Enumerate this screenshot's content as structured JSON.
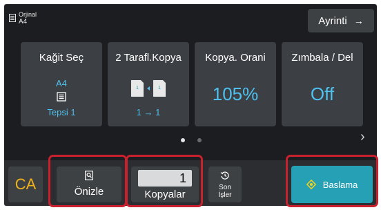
{
  "header": {
    "original_label": "Orjinal",
    "original_size": "A4",
    "detail_label": "Ayrinti",
    "detail_arrow": "→"
  },
  "functions": {
    "paper": {
      "title": "Kağit Seç",
      "size": "A4",
      "tray": "Tepsi 1"
    },
    "duplex": {
      "title": "2 Tarafl.Kopya",
      "mode": "1 → 1"
    },
    "ratio": {
      "title": "Kopya. Orani",
      "value": "105%"
    },
    "staple": {
      "title": "Zımbala / Del",
      "value": "Off"
    }
  },
  "pager": {
    "next_arrow": "›"
  },
  "bottom": {
    "ca_label": "CA",
    "preview_label": "Önizle",
    "copies_value": "1",
    "copies_label": "Kopyalar",
    "recent_label_1": "Son",
    "recent_label_2": "İşler",
    "start_label": "Baslama"
  },
  "colors": {
    "accent": "#4ec1f0",
    "ca": "#f0b21a",
    "start": "#25a0b5",
    "highlight": "#c8202d",
    "start_icon": "#f7d21a"
  }
}
